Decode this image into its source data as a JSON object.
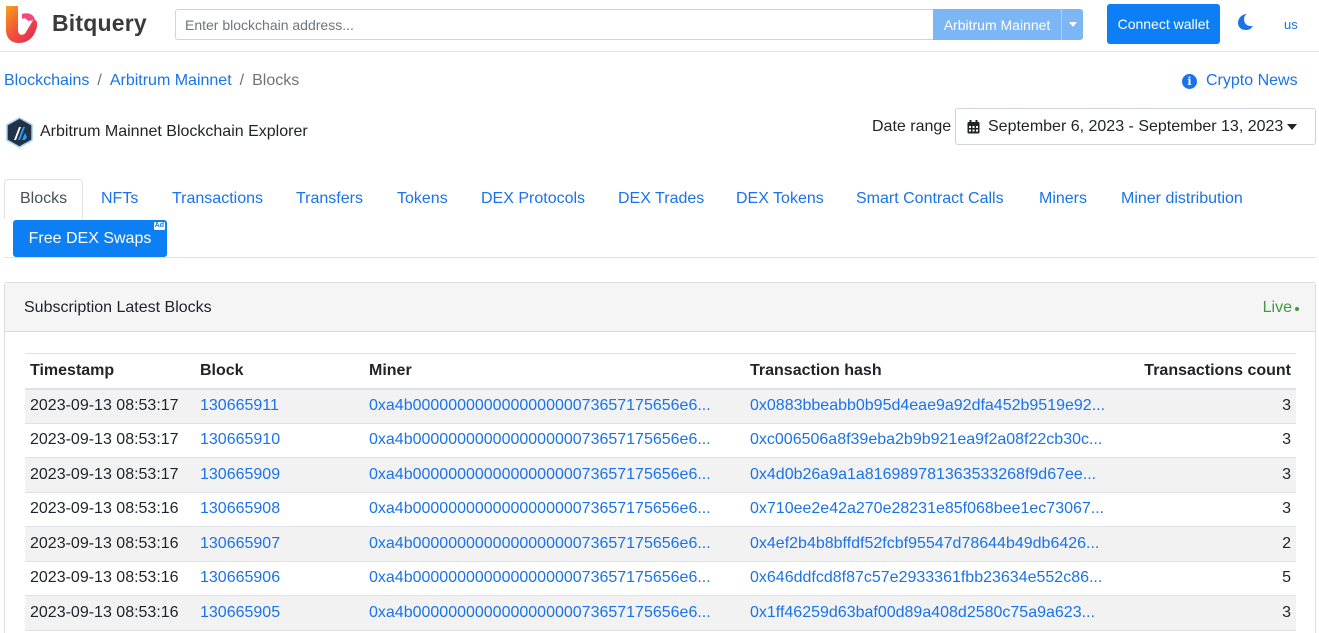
{
  "header": {
    "brand": "Bitquery",
    "search_placeholder": "Enter blockchain address...",
    "network": "Arbitrum Mainnet",
    "connect_label": "Connect wallet",
    "lang": "us"
  },
  "breadcrumb": {
    "items": [
      "Blockchains",
      "Arbitrum Mainnet",
      "Blocks"
    ],
    "separator": "/"
  },
  "news": {
    "label": "Crypto News"
  },
  "explorer": {
    "title": "Arbitrum Mainnet Blockchain Explorer",
    "date_label": "Date range",
    "date_value": "September 6, 2023 - September 13, 2023"
  },
  "tabs": [
    "Blocks",
    "NFTs",
    "Transactions",
    "Transfers",
    "Tokens",
    "DEX Protocols",
    "DEX Trades",
    "DEX Tokens",
    "Smart Contract Calls",
    "Miners",
    "Miner distribution"
  ],
  "ad_button": {
    "label": "Free DEX Swaps",
    "badge": "Ad"
  },
  "card": {
    "title": "Subscription Latest Blocks",
    "live": "Live"
  },
  "table": {
    "columns": [
      "Timestamp",
      "Block",
      "Miner",
      "Transaction hash",
      "Transactions count"
    ],
    "rows": [
      [
        "2023-09-13 08:53:17",
        "130665911",
        "0xa4b000000000000000000073657175656e6...",
        "0x0883bbeabb0b95d4eae9a92dfa452b9519e92...",
        "3"
      ],
      [
        "2023-09-13 08:53:17",
        "130665910",
        "0xa4b000000000000000000073657175656e6...",
        "0xc006506a8f39eba2b9b921ea9f2a08f22cb30c...",
        "3"
      ],
      [
        "2023-09-13 08:53:17",
        "130665909",
        "0xa4b000000000000000000073657175656e6...",
        "0x4d0b26a9a1a816989781363533268f9d67ee...",
        "3"
      ],
      [
        "2023-09-13 08:53:16",
        "130665908",
        "0xa4b000000000000000000073657175656e6...",
        "0x710ee2e42a270e28231e85f068bee1ec73067...",
        "3"
      ],
      [
        "2023-09-13 08:53:16",
        "130665907",
        "0xa4b000000000000000000073657175656e6...",
        "0x4ef2b4b8bffdf52fcbf95547d78644b49db6426...",
        "2"
      ],
      [
        "2023-09-13 08:53:16",
        "130665906",
        "0xa4b000000000000000000073657175656e6...",
        "0x646ddfcd8f87c57e2933361fbb23634e552c86...",
        "5"
      ],
      [
        "2023-09-13 08:53:16",
        "130665905",
        "0xa4b000000000000000000073657175656e6...",
        "0x1ff46259d63baf00d89a408d2580c75a9a623...",
        "3"
      ]
    ]
  },
  "colors": {
    "link": "#1a73e8",
    "primary_button": "#0d7ff5",
    "network_button": "#7cb6f5",
    "live": "#3e9b3e"
  },
  "icons": [
    "bitquery-logo",
    "chevron-down-icon",
    "moon-icon",
    "info-icon",
    "arbitrum-logo",
    "calendar-icon",
    "live-dot-icon"
  ]
}
